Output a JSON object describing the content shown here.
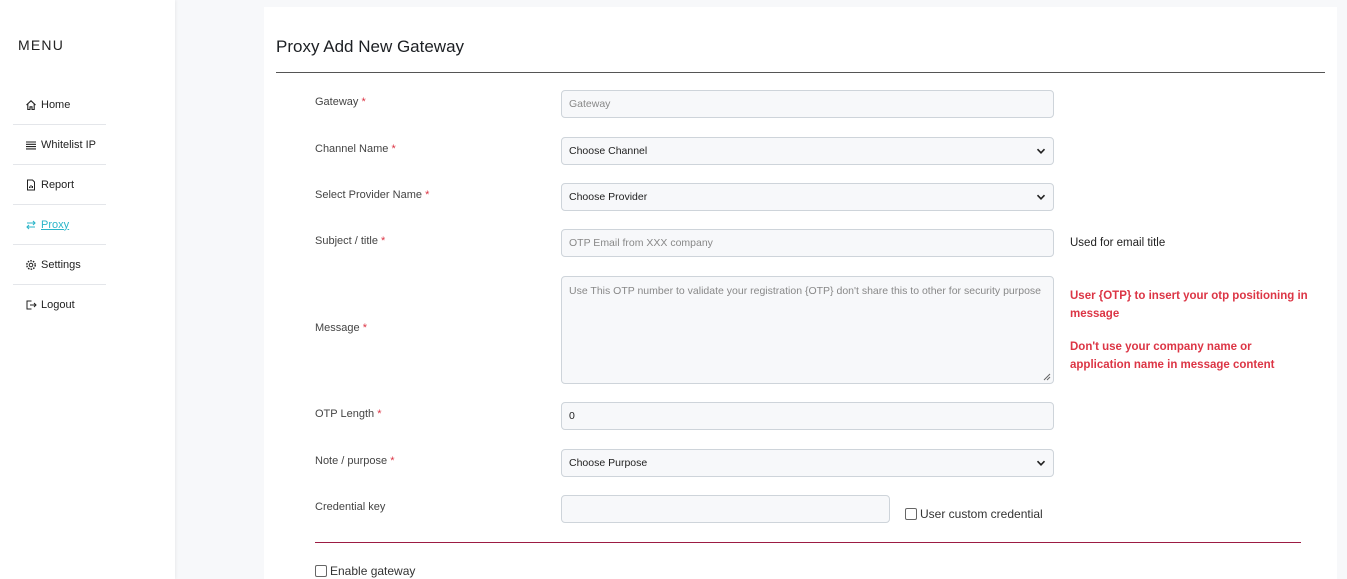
{
  "sidebar": {
    "title": "MENU",
    "items": [
      {
        "label": "Home",
        "icon": "home-icon"
      },
      {
        "label": "Whitelist IP",
        "icon": "list-icon"
      },
      {
        "label": "Report",
        "icon": "report-icon"
      },
      {
        "label": "Proxy",
        "icon": "swap-icon",
        "active": true
      },
      {
        "label": "Settings",
        "icon": "gear-icon"
      },
      {
        "label": "Logout",
        "icon": "logout-icon"
      }
    ]
  },
  "page": {
    "title": "Proxy Add New Gateway"
  },
  "form": {
    "required_mark": "*",
    "gateway": {
      "label": "Gateway",
      "placeholder": "Gateway"
    },
    "channel": {
      "label": "Channel Name",
      "value": "Choose Channel"
    },
    "provider": {
      "label": "Select Provider Name",
      "value": "Choose Provider"
    },
    "subject": {
      "label": "Subject / title",
      "placeholder": "OTP Email from XXX company",
      "hint": "Used for email title"
    },
    "message": {
      "label": "Message",
      "placeholder": "Use This OTP number to validate your registration {OTP} don't share this to other for security purpose",
      "hint1": "User {OTP} to insert your otp positioning in message",
      "hint2": "Don't use your company name or application name in message content"
    },
    "otp_length": {
      "label": "OTP Length",
      "value": "0"
    },
    "purpose": {
      "label": "Note / purpose",
      "value": "Choose Purpose"
    },
    "credential": {
      "label": "Credential key",
      "value": "",
      "checkbox_label": "User custom credential"
    },
    "enable_gateway": {
      "label": "Enable gateway",
      "checked": false
    }
  },
  "colors": {
    "accent": "#2bb5c9",
    "required": "#dc3545",
    "divider": "#9c1b43"
  }
}
